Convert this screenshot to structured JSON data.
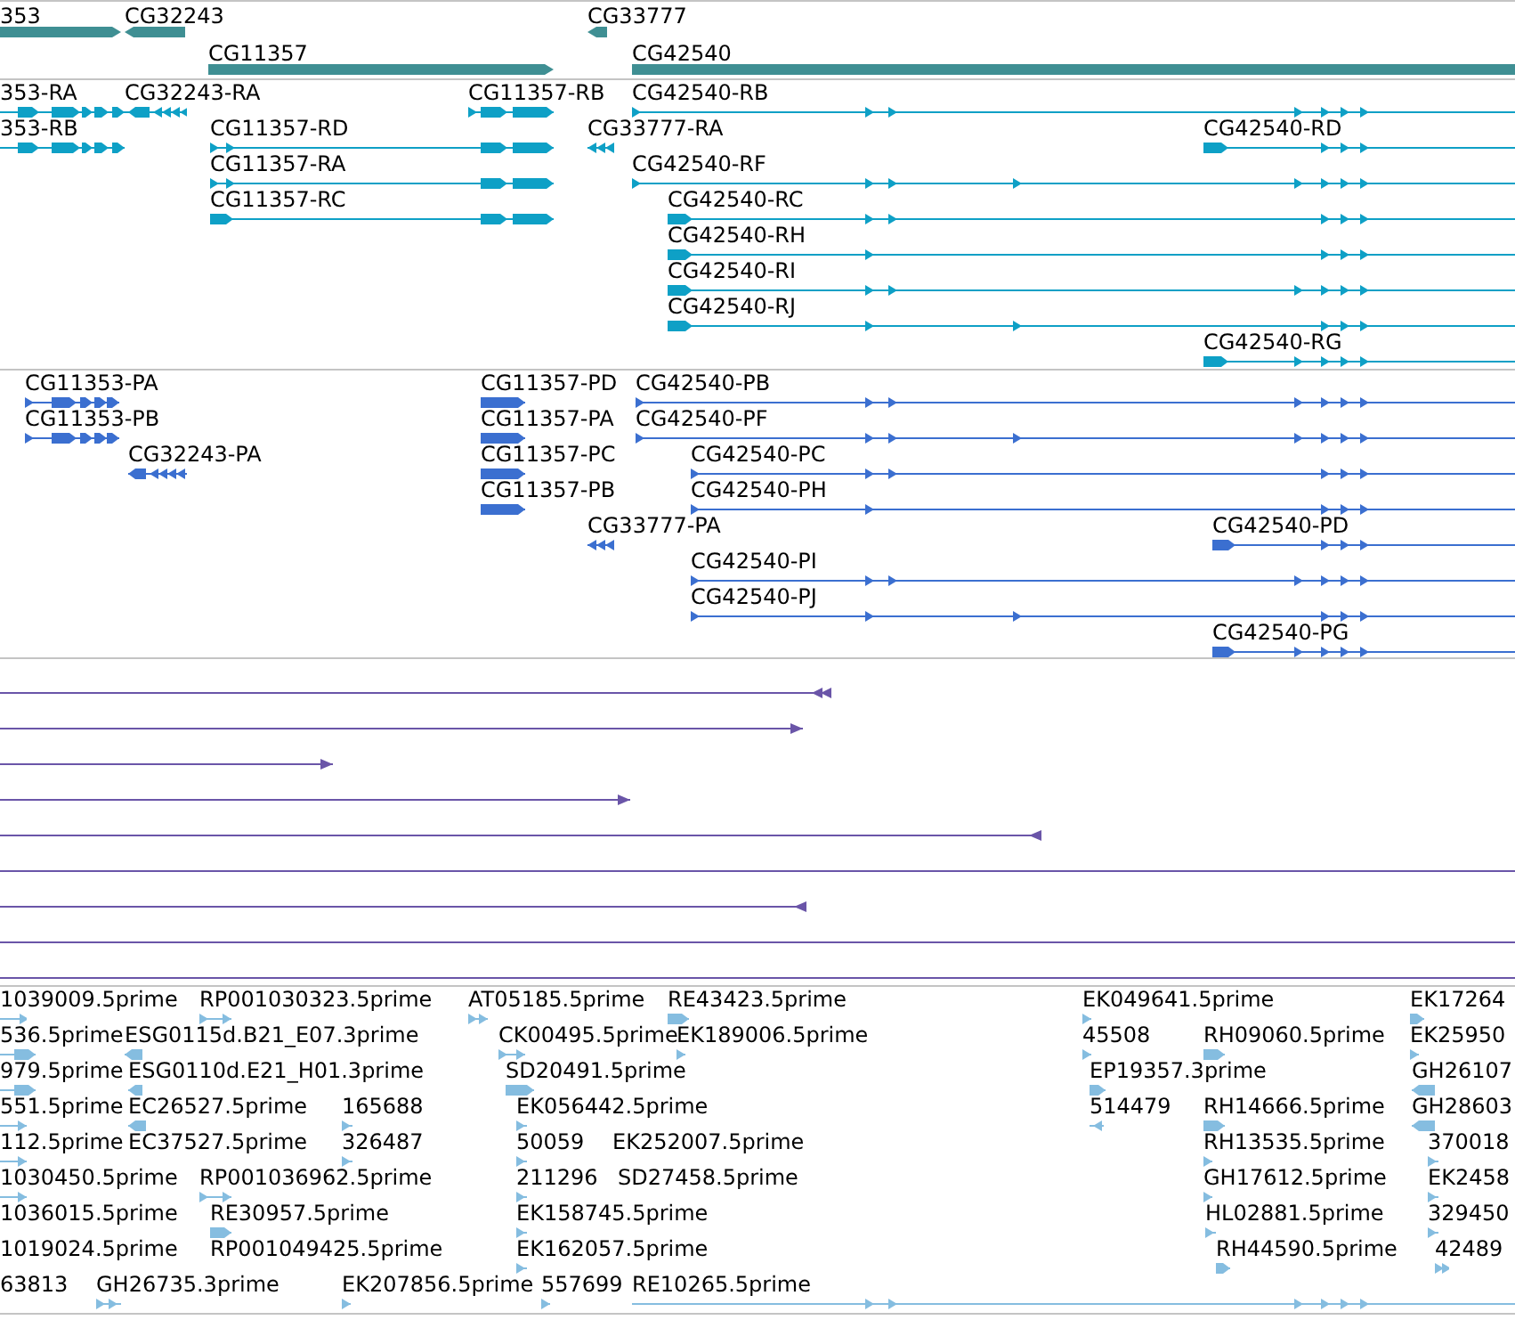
{
  "tracks": [
    {
      "kind": "genes",
      "features": [
        {
          "label": "353"
        },
        {
          "label": "CG32243"
        },
        {
          "label": "CG33777"
        },
        {
          "label": "CG11357"
        },
        {
          "label": "CG42540"
        }
      ]
    },
    {
      "kind": "transcripts",
      "features": [
        {
          "label": "353-RA"
        },
        {
          "label": "CG32243-RA"
        },
        {
          "label": "CG11357-RB"
        },
        {
          "label": "CG42540-RB"
        },
        {
          "label": "353-RB"
        },
        {
          "label": "CG11357-RD"
        },
        {
          "label": "CG33777-RA"
        },
        {
          "label": "CG42540-RD"
        },
        {
          "label": "CG11357-RA"
        },
        {
          "label": "CG42540-RF"
        },
        {
          "label": "CG11357-RC"
        },
        {
          "label": "CG42540-RC"
        },
        {
          "label": "CG42540-RH"
        },
        {
          "label": "CG42540-RI"
        },
        {
          "label": "CG42540-RJ"
        },
        {
          "label": "CG42540-RG"
        }
      ]
    },
    {
      "kind": "proteins",
      "features": [
        {
          "label": "CG11353-PA"
        },
        {
          "label": "CG11357-PD"
        },
        {
          "label": "CG42540-PB"
        },
        {
          "label": "CG11353-PB"
        },
        {
          "label": "CG11357-PA"
        },
        {
          "label": "CG42540-PF"
        },
        {
          "label": "CG32243-PA"
        },
        {
          "label": "CG11357-PC"
        },
        {
          "label": "CG42540-PC"
        },
        {
          "label": "CG11357-PB"
        },
        {
          "label": "CG42540-PH"
        },
        {
          "label": "CG33777-PA"
        },
        {
          "label": "CG42540-PD"
        },
        {
          "label": "CG42540-PI"
        },
        {
          "label": "CG42540-PJ"
        },
        {
          "label": "CG42540-PG"
        }
      ]
    },
    {
      "kind": "alignments"
    },
    {
      "kind": "ests",
      "features": [
        {
          "label": "1039009.5prime"
        },
        {
          "label": "RP001030323.5prime"
        },
        {
          "label": "AT05185.5prime"
        },
        {
          "label": "RE43423.5prime"
        },
        {
          "label": "EK049641.5prime"
        },
        {
          "label": "EK17264"
        },
        {
          "label": "536.5prime"
        },
        {
          "label": "ESG0115d.B21_E07.3prime"
        },
        {
          "label": "CK00495.5prime"
        },
        {
          "label": "EK189006.5prime"
        },
        {
          "label": "45508"
        },
        {
          "label": "RH09060.5prime"
        },
        {
          "label": "EK25950"
        },
        {
          "label": "979.5prime"
        },
        {
          "label": "ESG0110d.E21_H01.3prime"
        },
        {
          "label": "SD20491.5prime"
        },
        {
          "label": "EP19357.3prime"
        },
        {
          "label": "GH26107"
        },
        {
          "label": "551.5prime"
        },
        {
          "label": "EC26527.5prime"
        },
        {
          "label": "165688"
        },
        {
          "label": "EK056442.5prime"
        },
        {
          "label": "514479"
        },
        {
          "label": "RH14666.5prime"
        },
        {
          "label": "GH28603"
        },
        {
          "label": "112.5prime"
        },
        {
          "label": "EC37527.5prime"
        },
        {
          "label": "326487"
        },
        {
          "label": "50059"
        },
        {
          "label": "EK252007.5prime"
        },
        {
          "label": "RH13535.5prime"
        },
        {
          "label": "370018"
        },
        {
          "label": "1030450.5prime"
        },
        {
          "label": "RP001036962.5prime"
        },
        {
          "label": "211296"
        },
        {
          "label": "SD27458.5prime"
        },
        {
          "label": "GH17612.5prime"
        },
        {
          "label": "EK2458"
        },
        {
          "label": "1036015.5prime"
        },
        {
          "label": "RE30957.5prime"
        },
        {
          "label": "EK158745.5prime"
        },
        {
          "label": "HL02881.5prime"
        },
        {
          "label": "329450"
        },
        {
          "label": "1019024.5prime"
        },
        {
          "label": "RP001049425.5prime"
        },
        {
          "label": "EK162057.5prime"
        },
        {
          "label": "RH44590.5prime"
        },
        {
          "label": "42489"
        },
        {
          "label": "63813"
        },
        {
          "label": "GH26735.3prime"
        },
        {
          "label": "EK207856.5prime"
        },
        {
          "label": "557699"
        },
        {
          "label": "RE10265.5prime"
        }
      ]
    }
  ]
}
